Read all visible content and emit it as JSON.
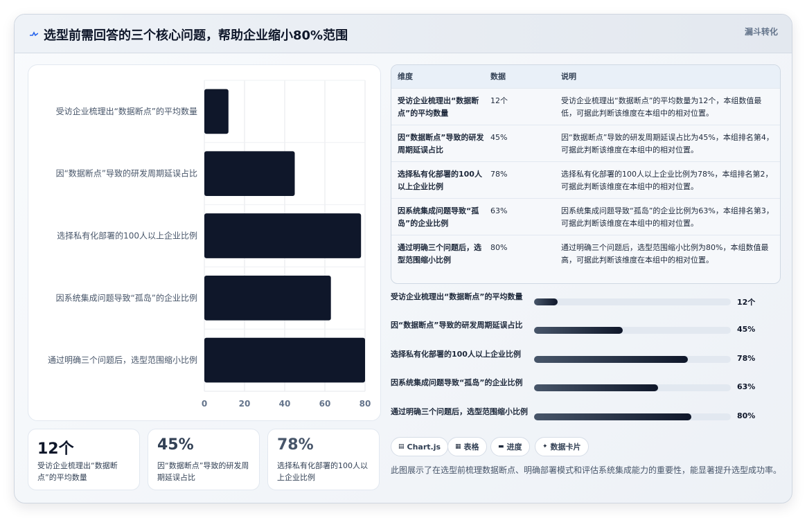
{
  "header": {
    "title": "选型前需回答的三个核心问题，帮助企业缩小80%范围",
    "tag": "漏斗转化"
  },
  "chart_data": {
    "type": "bar",
    "orientation": "horizontal",
    "categories": [
      "受访企业梳理出“数据断点”的平均数量",
      "因“数据断点”导致的研发周期延误占比",
      "选择私有化部署的100人以上企业比例",
      "因系统集成问题导致“孤岛”的企业比例",
      "通过明确三个问题后，选型范围缩小比例"
    ],
    "values": [
      12,
      45,
      78,
      63,
      80
    ],
    "xlim": [
      0,
      80
    ],
    "xticks": [
      "0",
      "20",
      "40",
      "60",
      "80"
    ],
    "bar_color": "#0f172a",
    "grid": true
  },
  "stats": [
    {
      "value": "12个",
      "label": "受访企业梳理出“数据断点”的平均数量"
    },
    {
      "value": "45%",
      "label": "因“数据断点”导致的研发周期延误占比"
    },
    {
      "value": "78%",
      "label": "选择私有化部署的100人以上企业比例"
    }
  ],
  "table": {
    "headers": [
      "维度",
      "数据",
      "说明"
    ],
    "rows": [
      {
        "dim": "受访企业梳理出“数据断点”的平均数量",
        "num": "12个",
        "note": "受访企业梳理出“数据断点”的平均数量为12个，本组数值最低，可据此判断该维度在本组中的相对位置。"
      },
      {
        "dim": "因“数据断点”导致的研发周期延误占比",
        "num": "45%",
        "note": "因“数据断点”导致的研发周期延误占比为45%，本组排名第4，可据此判断该维度在本组中的相对位置。"
      },
      {
        "dim": "选择私有化部署的100人以上企业比例",
        "num": "78%",
        "note": "选择私有化部署的100人以上企业比例为78%，本组排名第2，可据此判断该维度在本组中的相对位置。"
      },
      {
        "dim": "因系统集成问题导致“孤岛”的企业比例",
        "num": "63%",
        "note": "因系统集成问题导致“孤岛”的企业比例为63%，本组排名第3，可据此判断该维度在本组中的相对位置。"
      },
      {
        "dim": "通过明确三个问题后，选型范围缩小比例",
        "num": "80%",
        "note": "通过明确三个问题后，选型范围缩小比例为80%，本组数值最高，可据此判断该维度在本组中的相对位置。"
      }
    ]
  },
  "progress": [
    {
      "label": "受访企业梳理出“数据断点”的平均数量",
      "value": "12个",
      "fraction": 0.12
    },
    {
      "label": "因“数据断点”导致的研发周期延误占比",
      "value": "45%",
      "fraction": 0.45
    },
    {
      "label": "选择私有化部署的100人以上企业比例",
      "value": "78%",
      "fraction": 0.78
    },
    {
      "label": "因系统集成问题导致“孤岛”的企业比例",
      "value": "63%",
      "fraction": 0.63
    },
    {
      "label": "通过明确三个问题后，选型范围缩小比例",
      "value": "80%",
      "fraction": 0.8
    }
  ],
  "chips": [
    {
      "icon": "chart-icon",
      "glyph": "▤",
      "label": "Chart.js"
    },
    {
      "icon": "table-icon",
      "glyph": "▦",
      "label": "表格"
    },
    {
      "icon": "progress-icon",
      "glyph": "▬",
      "label": "进度"
    },
    {
      "icon": "sparkle-icon",
      "glyph": "✦",
      "label": "数据卡片"
    }
  ],
  "description": "此图展示了在选型前梳理数据断点、明确部署模式和评估系统集成能力的重要性，能显著提升选型成功率。"
}
